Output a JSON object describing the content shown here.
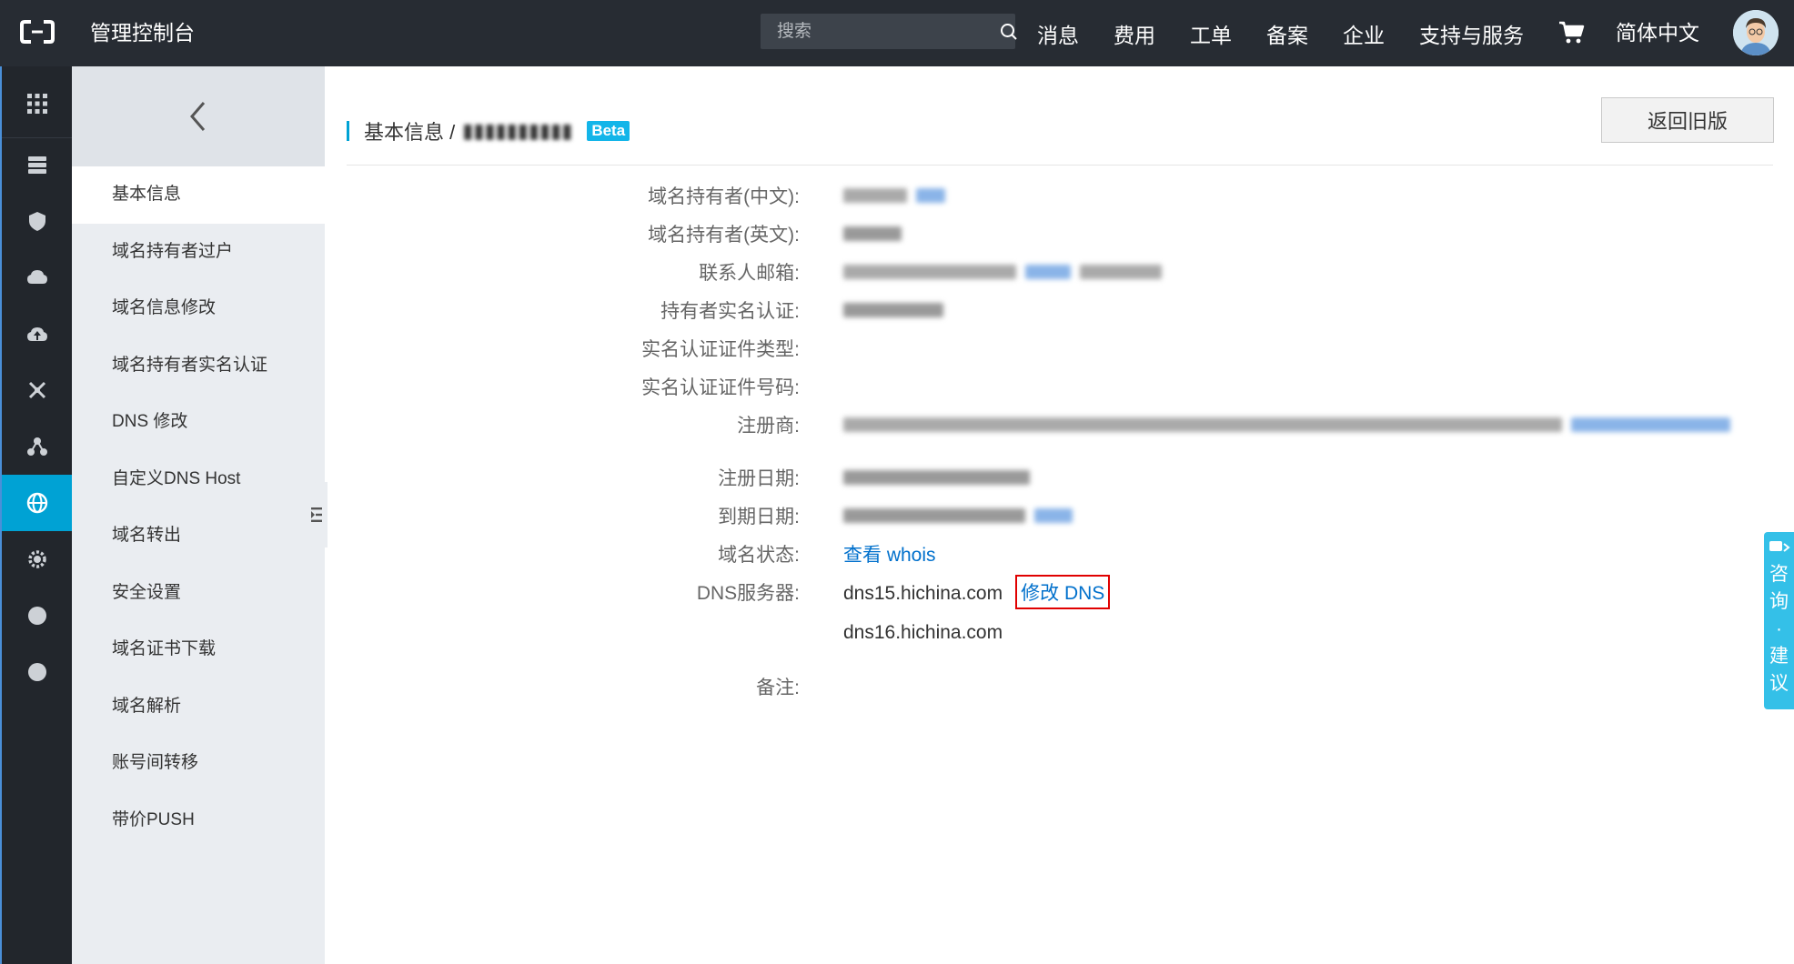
{
  "topbar": {
    "title": "管理控制台",
    "search_placeholder": "搜索",
    "nav": [
      "消息",
      "费用",
      "工单",
      "备案",
      "企业",
      "支持与服务"
    ],
    "language": "简体中文"
  },
  "sidebar": {
    "items": [
      "基本信息",
      "域名持有者过户",
      "域名信息修改",
      "域名持有者实名认证",
      "DNS 修改",
      "自定义DNS Host",
      "域名转出",
      "安全设置",
      "域名证书下载",
      "域名解析",
      "账号间转移",
      "带价PUSH"
    ],
    "active_index": 0
  },
  "main": {
    "breadcrumb": "基本信息 /",
    "beta": "Beta",
    "old_version_button": "返回旧版",
    "fields": {
      "owner_cn": "域名持有者(中文):",
      "owner_en": "域名持有者(英文):",
      "email": "联系人邮箱:",
      "realname": "持有者实名认证:",
      "cert_type": "实名认证证件类型:",
      "cert_no": "实名认证证件号码:",
      "registrar": "注册商:",
      "reg_date": "注册日期:",
      "exp_date": "到期日期:",
      "status": "域名状态:",
      "dns": "DNS服务器:",
      "note": "备注:"
    },
    "whois_link": "查看 whois",
    "dns_servers": [
      "dns15.hichina.com",
      "dns16.hichina.com"
    ],
    "modify_dns": "修改 DNS"
  },
  "consult": [
    "咨",
    "询",
    "·",
    "建",
    "议"
  ],
  "colors": {
    "topbar": "#272c33",
    "rail": "#22262c",
    "rail_active": "#00a2d4",
    "sidebar": "#eaedf1",
    "link": "#0070cc",
    "highlight": "#e00000",
    "beta": "#13b5e9"
  }
}
